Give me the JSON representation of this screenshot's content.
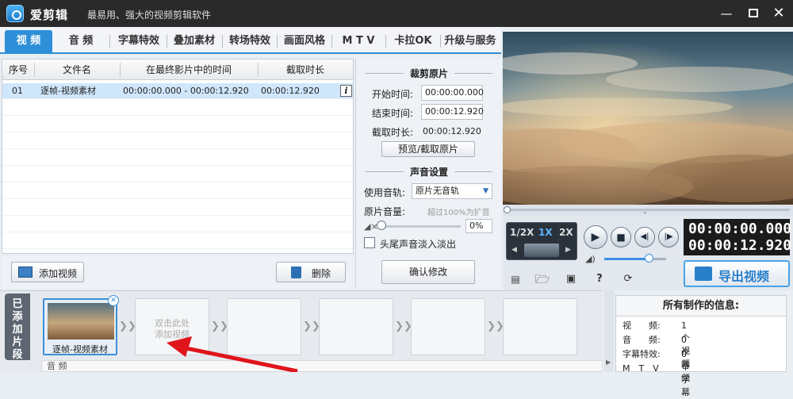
{
  "app": {
    "name": "爱剪辑",
    "slogan": "最易用、强大的视频剪辑软件"
  },
  "tabs": [
    "视 频",
    "音 频",
    "字幕特效",
    "叠加素材",
    "转场特效",
    "画面风格",
    "M T V",
    "卡拉OK",
    "升级与服务"
  ],
  "file_table": {
    "headers": [
      "序号",
      "文件名",
      "在最终影片中的时间",
      "截取时长"
    ],
    "rows": [
      {
        "index": "01",
        "name": "逐帧-视频素材",
        "time": "00:00:00.000 - 00:00:12.920",
        "duration": "00:00:12.920"
      }
    ]
  },
  "left_buttons": {
    "add_video": "添加视频",
    "delete": "删除"
  },
  "trim": {
    "title": "裁剪原片",
    "start_label": "开始时间:",
    "start_value": "00:00:00.000",
    "end_label": "结束时间:",
    "end_value": "00:00:12.920",
    "duration_label": "截取时长:",
    "duration_value": "00:00:12.920",
    "preview_button": "预览/截取原片"
  },
  "audio_settings": {
    "title": "声音设置",
    "track_label": "使用音轨:",
    "track_value": "原片无音轨",
    "volume_label": "原片音量:",
    "volume_hint": "超过100%为扩音",
    "volume_value": "0%",
    "volume_level": 0,
    "fade_label": "头尾声音淡入淡出",
    "confirm_button": "确认修改"
  },
  "player": {
    "speed_half": "1/2X",
    "speed_one": "1X",
    "speed_two": "2X",
    "timecode_current": "00:00:00.000",
    "timecode_total": "00:00:12.920",
    "volume_level": 0.72
  },
  "export_button": "导出视频",
  "timeline": {
    "added_label": "已添加片段",
    "clip_name": "逐帧-视频素材",
    "empty_hint_1": "双击此处",
    "empty_hint_2": "添加视频",
    "audio_label": "音 频"
  },
  "info_panel": {
    "title": "所有制作的信息:",
    "rows": [
      {
        "label": "视　　频:",
        "value": "1个视频"
      },
      {
        "label": "音　　频:",
        "value": "0个音频"
      },
      {
        "label": "字幕特效:",
        "value": "0个字幕"
      },
      {
        "label": "M　T　V",
        "value": ""
      }
    ]
  },
  "colors": {
    "accent": "#2e8fd8",
    "titlebar": "#2a2a2a",
    "selected_row": "#cfe6fb",
    "annotation_arrow": "#e0141b"
  }
}
